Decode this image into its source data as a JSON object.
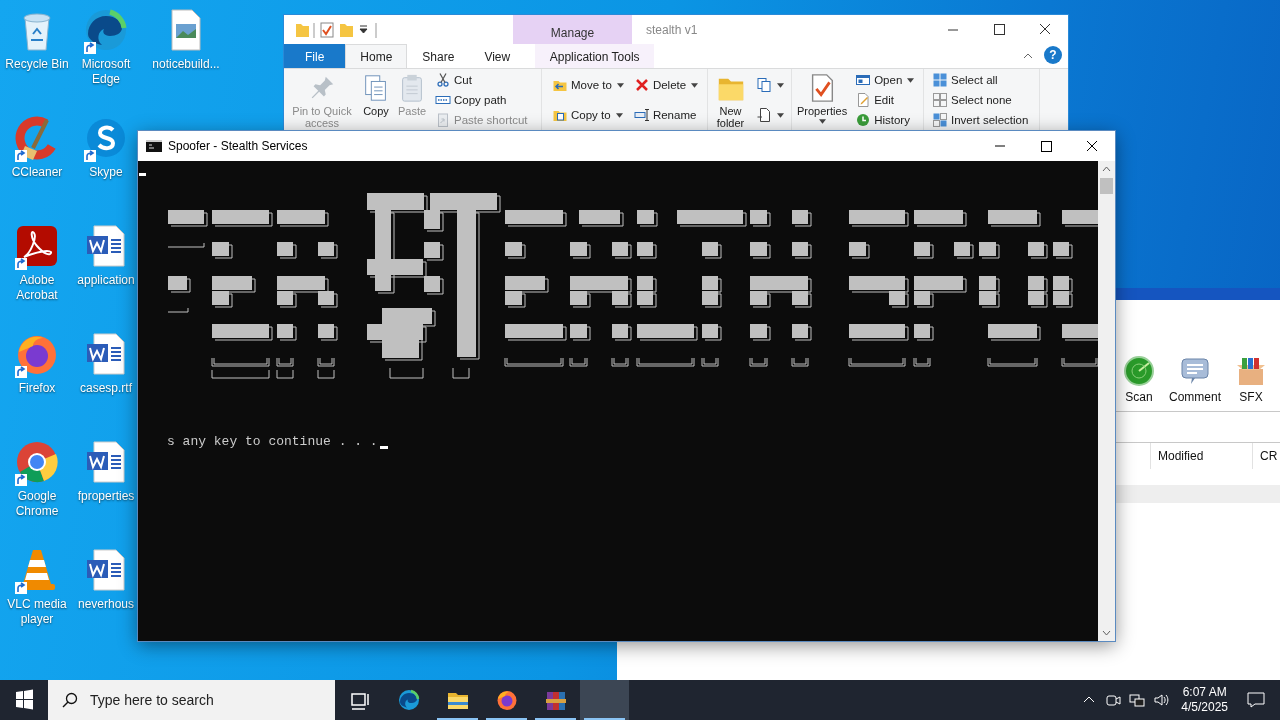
{
  "desktop": {
    "icons": [
      {
        "label": "Recycle Bin",
        "kind": "recycle",
        "shortcut": false
      },
      {
        "label": "CCleaner",
        "kind": "ccleaner",
        "shortcut": true
      },
      {
        "label": "Adobe Acrobat",
        "kind": "acrobat",
        "shortcut": true
      },
      {
        "label": "Firefox",
        "kind": "firefox",
        "shortcut": true
      },
      {
        "label": "Google Chrome",
        "kind": "chrome",
        "shortcut": true
      },
      {
        "label": "VLC media player",
        "kind": "vlc",
        "shortcut": true
      },
      {
        "label": "Microsoft Edge",
        "kind": "edge",
        "shortcut": true
      },
      {
        "label": "Skype",
        "kind": "skype",
        "shortcut": true
      },
      {
        "label": "application",
        "kind": "word",
        "shortcut": false
      },
      {
        "label": "casesp.rtf",
        "kind": "word",
        "shortcut": false
      },
      {
        "label": "fproperties",
        "kind": "word",
        "shortcut": false
      },
      {
        "label": "neverhous",
        "kind": "word",
        "shortcut": false
      },
      {
        "label": "noticebuild...",
        "kind": "image",
        "shortcut": false
      }
    ]
  },
  "explorer": {
    "title": "stealth v1",
    "context_tab": "Manage",
    "help": "?",
    "tabs": [
      {
        "label": "File",
        "kind": "file",
        "selected": false
      },
      {
        "label": "Home",
        "kind": "tab",
        "selected": true
      },
      {
        "label": "Share",
        "kind": "tab",
        "selected": false
      },
      {
        "label": "View",
        "kind": "tab",
        "selected": false
      },
      {
        "label": "Application Tools",
        "kind": "context",
        "selected": false
      }
    ],
    "ribbon": {
      "groups": [
        {
          "columns": [
            {
              "kind": "large",
              "items": [
                {
                  "label": "Pin to Quick access",
                  "kind": "pin",
                  "disabled": true,
                  "dropdown": false
                }
              ]
            },
            {
              "kind": "large",
              "items": [
                {
                  "label": "Copy",
                  "kind": "copy",
                  "disabled": false,
                  "dropdown": false
                }
              ]
            },
            {
              "kind": "large",
              "items": [
                {
                  "label": "Paste",
                  "kind": "paste",
                  "disabled": true,
                  "dropdown": false
                }
              ]
            },
            {
              "kind": "small",
              "items": [
                {
                  "label": "Cut",
                  "kind": "cut",
                  "disabled": false,
                  "dropdown": false
                },
                {
                  "label": "Copy path",
                  "kind": "copy-path",
                  "disabled": false,
                  "dropdown": false
                },
                {
                  "label": "Paste shortcut",
                  "kind": "paste-shortcut",
                  "disabled": true,
                  "dropdown": false
                }
              ]
            }
          ]
        },
        {
          "columns": [
            {
              "kind": "small",
              "items": [
                {
                  "label": "Move to",
                  "kind": "move-to",
                  "disabled": false,
                  "dropdown": true
                },
                {
                  "label": "Copy to",
                  "kind": "copy-to",
                  "disabled": false,
                  "dropdown": true
                }
              ]
            },
            {
              "kind": "small",
              "items": [
                {
                  "label": "Delete",
                  "kind": "delete",
                  "disabled": false,
                  "dropdown": true
                },
                {
                  "label": "Rename",
                  "kind": "rename",
                  "disabled": false,
                  "dropdown": false
                }
              ]
            }
          ]
        },
        {
          "columns": [
            {
              "kind": "large",
              "items": [
                {
                  "label": "New folder",
                  "kind": "new-folder",
                  "disabled": false,
                  "dropdown": false
                }
              ]
            },
            {
              "kind": "small",
              "items": [
                {
                  "kind": "new-item",
                  "disabled": false,
                  "dropdown": true
                },
                {
                  "kind": "easy-access",
                  "disabled": false,
                  "dropdown": true
                }
              ]
            }
          ]
        },
        {
          "columns": [
            {
              "kind": "large",
              "items": [
                {
                  "label": "Properties",
                  "kind": "properties",
                  "disabled": false,
                  "dropdown": true
                }
              ]
            },
            {
              "kind": "small",
              "items": [
                {
                  "label": "Open",
                  "kind": "open",
                  "disabled": false,
                  "dropdown": true
                },
                {
                  "label": "Edit",
                  "kind": "edit",
                  "disabled": false,
                  "dropdown": false
                },
                {
                  "label": "History",
                  "kind": "history",
                  "disabled": false,
                  "dropdown": false
                }
              ]
            }
          ]
        },
        {
          "columns": [
            {
              "kind": "small",
              "items": [
                {
                  "label": "Select all",
                  "kind": "select-all",
                  "disabled": false,
                  "dropdown": false
                },
                {
                  "label": "Select none",
                  "kind": "select-none",
                  "disabled": false,
                  "dropdown": false
                },
                {
                  "label": "Invert selection",
                  "kind": "invert-selection",
                  "disabled": false,
                  "dropdown": false
                }
              ]
            }
          ]
        }
      ]
    }
  },
  "archiver": {
    "toolbar": [
      {
        "label": "Scan",
        "kind": "scan"
      },
      {
        "label": "Comment",
        "kind": "comment"
      },
      {
        "label": "SFX",
        "kind": "sfx"
      }
    ],
    "columns": [
      "Modified",
      "CR"
    ]
  },
  "console": {
    "title": "Spoofer - Stealth Services",
    "prompt": "s any key to continue . . ."
  },
  "taskbar": {
    "search": {
      "placeholder": "Type here to search"
    },
    "apps": [
      {
        "kind": "taskview",
        "running": false,
        "active": false
      },
      {
        "kind": "edge",
        "running": false,
        "active": false
      },
      {
        "kind": "explorer",
        "running": true,
        "active": false
      },
      {
        "kind": "firefox",
        "running": true,
        "active": false
      },
      {
        "kind": "winrar",
        "running": true,
        "active": false
      },
      {
        "kind": "blank",
        "running": true,
        "active": true
      }
    ],
    "time": "6:07 AM",
    "date": "4/5/2025"
  }
}
